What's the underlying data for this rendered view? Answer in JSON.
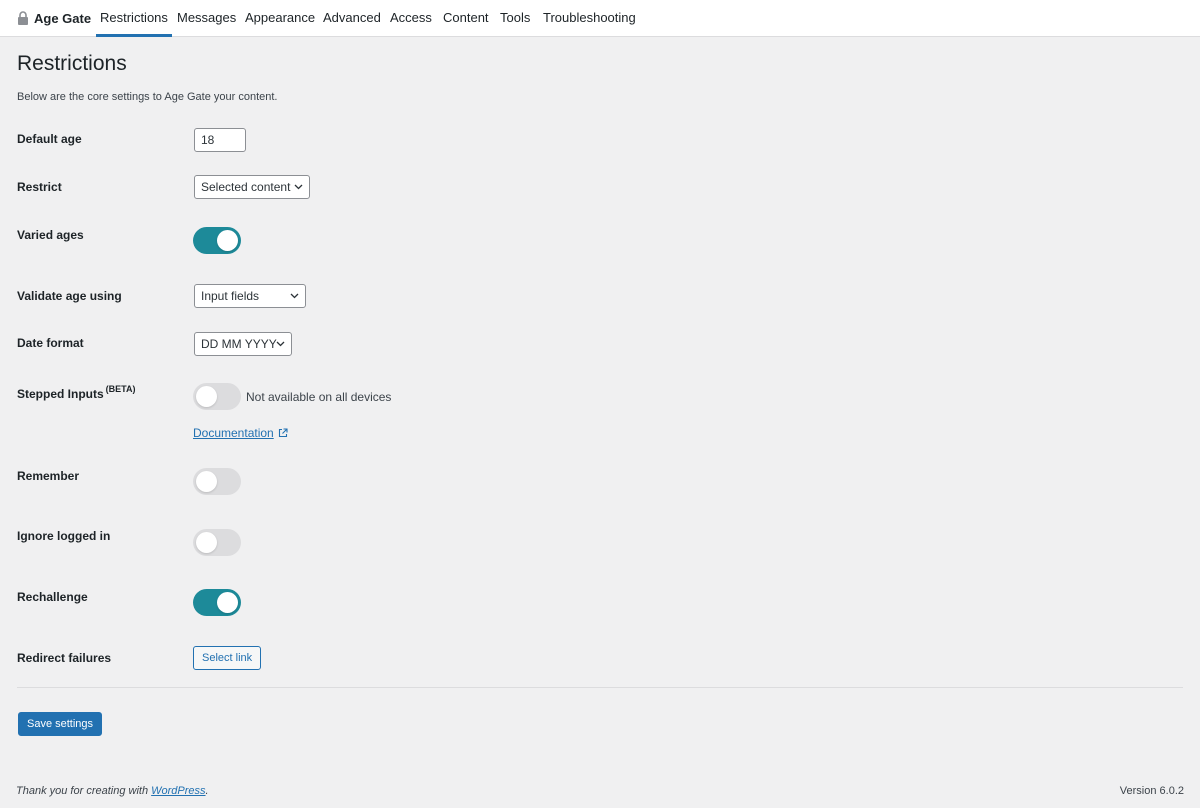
{
  "nav": {
    "brand": "Age Gate",
    "tabs": [
      {
        "label": "Restrictions",
        "active": true
      },
      {
        "label": "Messages"
      },
      {
        "label": "Appearance"
      },
      {
        "label": "Advanced"
      },
      {
        "label": "Access"
      },
      {
        "label": "Content"
      },
      {
        "label": "Tools"
      },
      {
        "label": "Troubleshooting"
      }
    ]
  },
  "page": {
    "title": "Restrictions",
    "description": "Below are the core settings to Age Gate your content."
  },
  "fields": {
    "default_age": {
      "label": "Default age",
      "value": "18"
    },
    "restrict": {
      "label": "Restrict",
      "value": "Selected content"
    },
    "varied_ages": {
      "label": "Varied ages",
      "enabled": true
    },
    "validate": {
      "label": "Validate age using",
      "value": "Input fields"
    },
    "date_format": {
      "label": "Date format",
      "value": "DD MM YYYY"
    },
    "stepped_inputs": {
      "label": "Stepped Inputs",
      "badge": "(BETA)",
      "enabled": false,
      "note": "Not available on all devices",
      "doc_link": "Documentation"
    },
    "remember": {
      "label": "Remember",
      "enabled": false
    },
    "ignore_logged_in": {
      "label": "Ignore logged in",
      "enabled": false
    },
    "rechallenge": {
      "label": "Rechallenge",
      "enabled": true
    },
    "redirect_failures": {
      "label": "Redirect failures",
      "button": "Select link"
    }
  },
  "actions": {
    "save": "Save settings"
  },
  "footer": {
    "thanks_prefix": "Thank you for creating with ",
    "thanks_link": "WordPress",
    "thanks_suffix": ".",
    "version": "Version 6.0.2"
  },
  "colors": {
    "accent": "#2271b1",
    "toggle_on": "#1d8a99",
    "toggle_off": "#dcdcde"
  }
}
